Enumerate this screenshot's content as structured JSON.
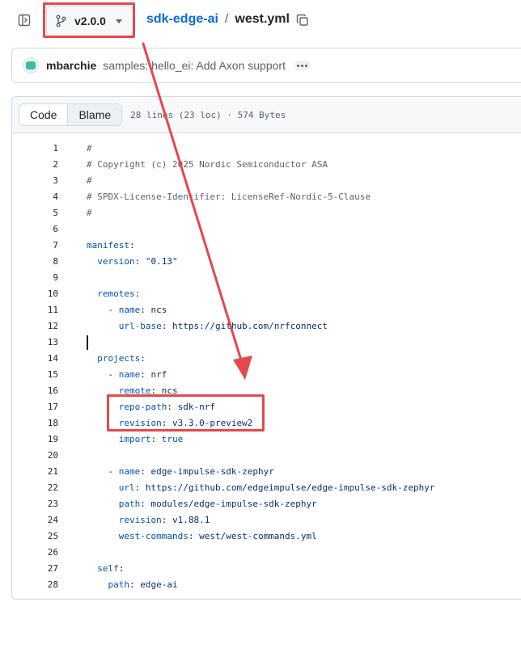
{
  "header": {
    "branch": "v2.0.0",
    "repo": "sdk-edge-ai",
    "separator": "/",
    "file": "west.yml",
    "icons": {
      "sidebar": "sidebar-toggle-icon",
      "branch": "git-branch-icon",
      "copy": "copy-icon"
    }
  },
  "commit": {
    "author": "mbarchie",
    "message": "samples: hello_ei: Add Axon support"
  },
  "file": {
    "tabs": [
      "Code",
      "Blame"
    ],
    "active_tab": "Code",
    "meta": "28 lines (23 loc) · 574 Bytes"
  },
  "code_lines": [
    {
      "n": "1",
      "segs": [
        {
          "t": "#",
          "c": "comment"
        }
      ]
    },
    {
      "n": "2",
      "segs": [
        {
          "t": "# Copyright (c) 2025 Nordic Semiconductor ASA",
          "c": "comment"
        }
      ]
    },
    {
      "n": "3",
      "segs": [
        {
          "t": "#",
          "c": "comment"
        }
      ]
    },
    {
      "n": "4",
      "segs": [
        {
          "t": "# SPDX-License-Identifier: LicenseRef-Nordic-5-Clause",
          "c": "comment"
        }
      ]
    },
    {
      "n": "5",
      "segs": [
        {
          "t": "#",
          "c": "comment"
        }
      ]
    },
    {
      "n": "6",
      "segs": []
    },
    {
      "n": "7",
      "segs": [
        {
          "t": "manifest",
          "c": "key"
        },
        {
          "t": ":",
          "c": "plain"
        }
      ]
    },
    {
      "n": "8",
      "segs": [
        {
          "t": "  version",
          "c": "key"
        },
        {
          "t": ": ",
          "c": "plain"
        },
        {
          "t": "\"0.13\"",
          "c": "val"
        }
      ]
    },
    {
      "n": "9",
      "segs": []
    },
    {
      "n": "10",
      "segs": [
        {
          "t": "  remotes",
          "c": "key"
        },
        {
          "t": ":",
          "c": "plain"
        }
      ]
    },
    {
      "n": "11",
      "segs": [
        {
          "t": "    - ",
          "c": "plain"
        },
        {
          "t": "name",
          "c": "key"
        },
        {
          "t": ": ",
          "c": "plain"
        },
        {
          "t": "ncs",
          "c": "val"
        }
      ]
    },
    {
      "n": "12",
      "segs": [
        {
          "t": "      url-base",
          "c": "key"
        },
        {
          "t": ": ",
          "c": "plain"
        },
        {
          "t": "https://github.com/nrfconnect",
          "c": "val"
        }
      ]
    },
    {
      "n": "13",
      "segs": [],
      "cursor": true
    },
    {
      "n": "14",
      "segs": [
        {
          "t": "  projects",
          "c": "key"
        },
        {
          "t": ":",
          "c": "plain"
        }
      ]
    },
    {
      "n": "15",
      "segs": [
        {
          "t": "    - ",
          "c": "plain"
        },
        {
          "t": "name",
          "c": "key"
        },
        {
          "t": ": ",
          "c": "plain"
        },
        {
          "t": "nrf",
          "c": "val"
        }
      ]
    },
    {
      "n": "16",
      "segs": [
        {
          "t": "      remote",
          "c": "key"
        },
        {
          "t": ": ",
          "c": "plain"
        },
        {
          "t": "ncs",
          "c": "val"
        }
      ]
    },
    {
      "n": "17",
      "segs": [
        {
          "t": "      repo-path",
          "c": "key"
        },
        {
          "t": ": ",
          "c": "plain"
        },
        {
          "t": "sdk-nrf",
          "c": "val"
        }
      ]
    },
    {
      "n": "18",
      "segs": [
        {
          "t": "      revision",
          "c": "key"
        },
        {
          "t": ": ",
          "c": "plain"
        },
        {
          "t": "v3.3.0-preview2",
          "c": "val"
        }
      ]
    },
    {
      "n": "19",
      "segs": [
        {
          "t": "      import",
          "c": "key"
        },
        {
          "t": ": ",
          "c": "plain"
        },
        {
          "t": "true",
          "c": "key"
        }
      ]
    },
    {
      "n": "20",
      "segs": []
    },
    {
      "n": "21",
      "segs": [
        {
          "t": "    - ",
          "c": "plain"
        },
        {
          "t": "name",
          "c": "key"
        },
        {
          "t": ": ",
          "c": "plain"
        },
        {
          "t": "edge-impulse-sdk-zephyr",
          "c": "val"
        }
      ]
    },
    {
      "n": "22",
      "segs": [
        {
          "t": "      url",
          "c": "key"
        },
        {
          "t": ": ",
          "c": "plain"
        },
        {
          "t": "https://github.com/edgeimpulse/edge-impulse-sdk-zephyr",
          "c": "val"
        }
      ]
    },
    {
      "n": "23",
      "segs": [
        {
          "t": "      path",
          "c": "key"
        },
        {
          "t": ": ",
          "c": "plain"
        },
        {
          "t": "modules/edge-impulse-sdk-zephyr",
          "c": "val"
        }
      ]
    },
    {
      "n": "24",
      "segs": [
        {
          "t": "      revision",
          "c": "key"
        },
        {
          "t": ": ",
          "c": "plain"
        },
        {
          "t": "v1.88.1",
          "c": "val"
        }
      ]
    },
    {
      "n": "25",
      "segs": [
        {
          "t": "      west-commands",
          "c": "key"
        },
        {
          "t": ": ",
          "c": "plain"
        },
        {
          "t": "west/west-commands.yml",
          "c": "val"
        }
      ]
    },
    {
      "n": "26",
      "segs": []
    },
    {
      "n": "27",
      "segs": [
        {
          "t": "  self",
          "c": "key"
        },
        {
          "t": ":",
          "c": "plain"
        }
      ]
    },
    {
      "n": "28",
      "segs": [
        {
          "t": "    path",
          "c": "key"
        },
        {
          "t": ": ",
          "c": "plain"
        },
        {
          "t": "edge-ai",
          "c": "val"
        }
      ]
    }
  ],
  "colors": {
    "annotation": "#e5484d",
    "link": "#0969da",
    "yaml_key": "#0550ae",
    "yaml_value": "#0a3069",
    "comment": "#59636e"
  }
}
